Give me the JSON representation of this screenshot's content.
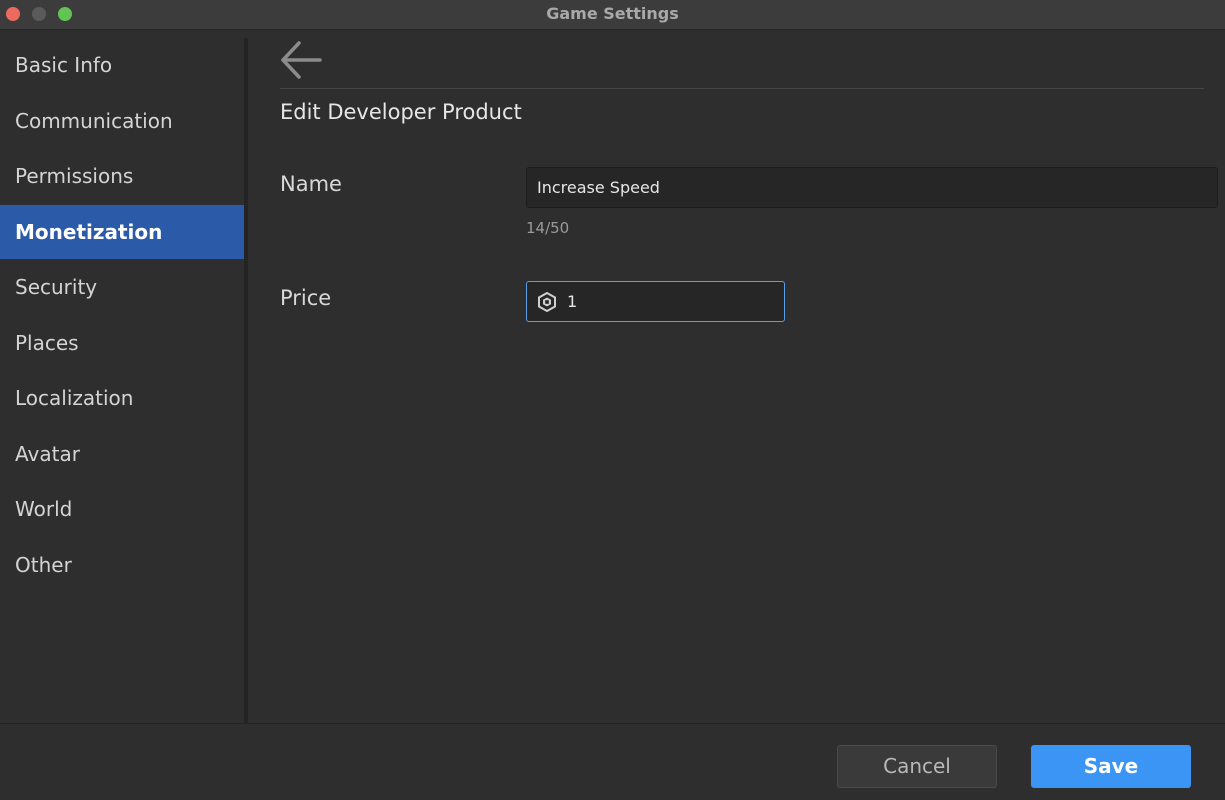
{
  "window": {
    "title": "Game Settings"
  },
  "sidebar": {
    "items": [
      {
        "label": "Basic Info"
      },
      {
        "label": "Communication"
      },
      {
        "label": "Permissions"
      },
      {
        "label": "Monetization",
        "active": true
      },
      {
        "label": "Security"
      },
      {
        "label": "Places"
      },
      {
        "label": "Localization"
      },
      {
        "label": "Avatar"
      },
      {
        "label": "World"
      },
      {
        "label": "Other"
      }
    ]
  },
  "main": {
    "back_icon": "arrow-left-icon",
    "title": "Edit Developer Product",
    "name_field": {
      "label": "Name",
      "value": "Increase Speed",
      "char_count": "14/50"
    },
    "price_field": {
      "label": "Price",
      "currency_icon": "robux-icon",
      "value": "1"
    }
  },
  "footer": {
    "cancel_label": "Cancel",
    "save_label": "Save"
  },
  "colors": {
    "accent_active": "#2a5aa8",
    "save_button": "#3b95f4",
    "focus_border": "#5a9ee8"
  }
}
